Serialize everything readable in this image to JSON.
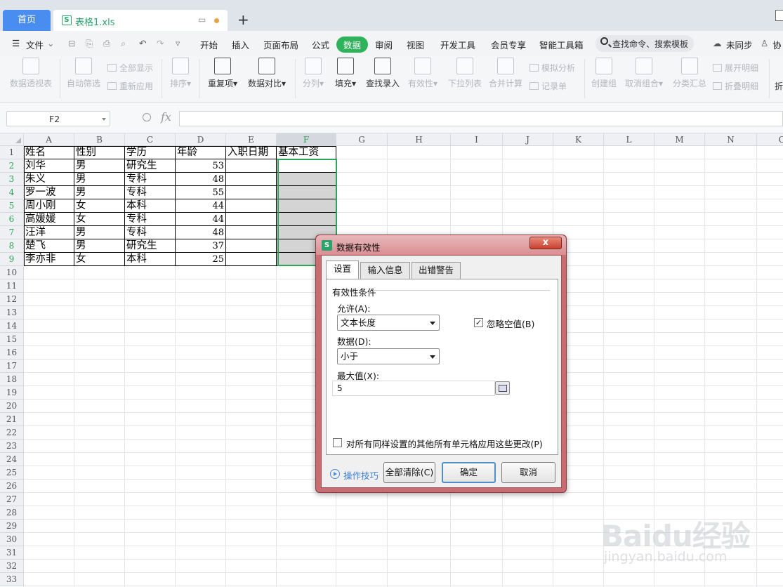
{
  "tabs": {
    "home": "首页",
    "file": "表格1.xls",
    "add": "+"
  },
  "menu": {
    "file": "文件",
    "items": [
      "开始",
      "插入",
      "页面布局",
      "公式",
      "数据",
      "审阅",
      "视图",
      "开发工具",
      "会员专享",
      "智能工具箱"
    ],
    "active": "数据",
    "search_placeholder": "查找命令、搜索模板",
    "sync": "未同步",
    "collab": "协"
  },
  "ribbon": {
    "pivot": "数据透视表",
    "autofilter": "自动筛选",
    "show_all": "全部显示",
    "reapply": "重新应用",
    "sort": "排序",
    "duplicates": "重复项",
    "compare": "数据对比",
    "split": "分列",
    "fill": "填充",
    "find_entry": "查找录入",
    "validity": "有效性",
    "dropdown_list": "下拉列表",
    "consolidate": "合并计算",
    "whatif": "模拟分析",
    "record_form": "记录单",
    "group": "创建组",
    "ungroup": "取消组合",
    "subtotal": "分类汇总",
    "expand": "展开明细",
    "collapse": "折叠明细",
    "more": "折"
  },
  "formula_bar": {
    "cell_ref": "F2",
    "fx": "fx",
    "value": ""
  },
  "sheet": {
    "columns": [
      "A",
      "B",
      "C",
      "D",
      "E",
      "F",
      "G",
      "H",
      "I",
      "J",
      "K",
      "L",
      "M",
      "N",
      "O"
    ],
    "selected_column": "F",
    "row_numbers": [
      "1",
      "2",
      "3",
      "4",
      "5",
      "6",
      "7",
      "8",
      "9",
      "10",
      "11",
      "12",
      "13",
      "14",
      "15",
      "16",
      "17",
      "18",
      "19",
      "20",
      "21",
      "22",
      "23",
      "24",
      "25",
      "26",
      "27",
      "28",
      "29",
      "30",
      "31",
      "32",
      "33"
    ],
    "headers": [
      "姓名",
      "性别",
      "学历",
      "年龄",
      "入职日期",
      "基本工资"
    ],
    "rows": [
      [
        "刘华",
        "男",
        "研究生",
        "53"
      ],
      [
        "朱义",
        "男",
        "专科",
        "48"
      ],
      [
        "罗一波",
        "男",
        "专科",
        "55"
      ],
      [
        "周小刚",
        "女",
        "本科",
        "44"
      ],
      [
        "高媛媛",
        "女",
        "专科",
        "44"
      ],
      [
        "汪洋",
        "男",
        "专科",
        "48"
      ],
      [
        "楚飞",
        "男",
        "研究生",
        "37"
      ],
      [
        "李亦非",
        "女",
        "本科",
        "25"
      ]
    ]
  },
  "dialog": {
    "title": "数据有效性",
    "close": "x",
    "tabs": [
      "设置",
      "输入信息",
      "出错警告"
    ],
    "group_label": "有效性条件",
    "allow_label": "允许(A):",
    "allow_value": "文本长度",
    "ignore_blank_label": "忽略空值(B)",
    "ignore_blank_checked": true,
    "data_label": "数据(D):",
    "data_value": "小于",
    "max_label": "最大值(X):",
    "max_value": "5",
    "apply_all_label": "对所有同样设置的其他所有单元格应用这些更改(P)",
    "apply_all_checked": false,
    "tips": "操作技巧",
    "clear_all": "全部清除(C)",
    "ok": "确定",
    "cancel": "取消"
  },
  "watermark": {
    "brand": "Baidu经验",
    "url": "jingyan.baidu.com"
  }
}
